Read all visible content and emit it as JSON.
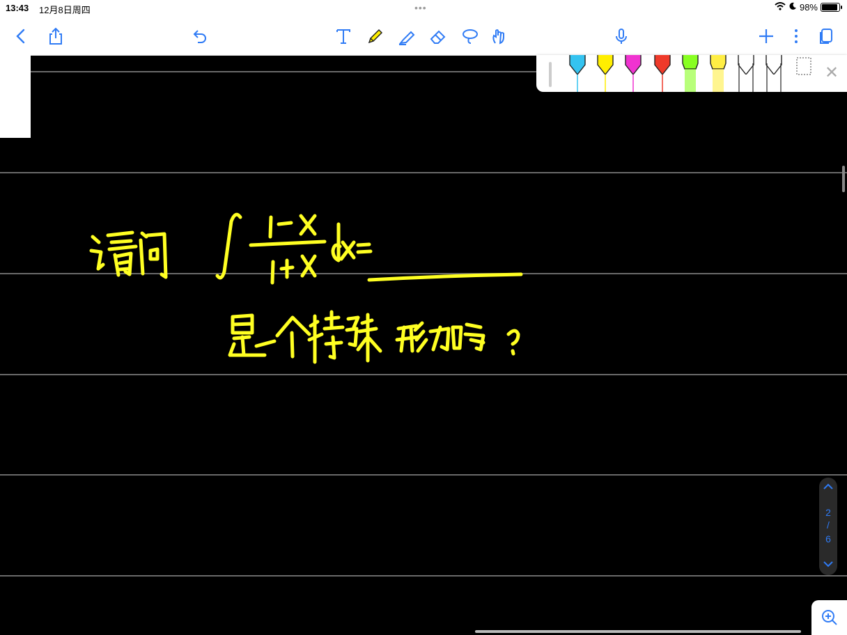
{
  "status": {
    "time": "13:43",
    "date": "12月8日周四",
    "battery": "98%",
    "dots": "•••"
  },
  "toolbar": {
    "buttons": [
      "back-icon",
      "share-icon",
      "undo-icon",
      "text-tool-icon",
      "pen-tool-icon",
      "highlighter-tool-icon",
      "eraser-tool-icon",
      "lasso-tool-icon",
      "hand-gesture-icon",
      "microphone-icon",
      "add-page-icon",
      "more-icon",
      "pages-icon"
    ]
  },
  "pen_colors": [
    "#34c3f0",
    "#ffee00",
    "#f033d0",
    "#ef3a2a",
    "#88ff22",
    "#ffee44",
    "#ffffff",
    "#ffffff"
  ],
  "pager": {
    "current": "2",
    "separator": "/",
    "total": "6"
  },
  "handwriting": {
    "line1_label": "请问",
    "integral_numerator": "1-x",
    "integral_denominator": "1+x",
    "integral_tail": "dx=",
    "line2": "是一个特殊形式吗？"
  },
  "colors": {
    "ink": "#ffff22",
    "accent": "#2f7bf5",
    "background": "#000000"
  }
}
